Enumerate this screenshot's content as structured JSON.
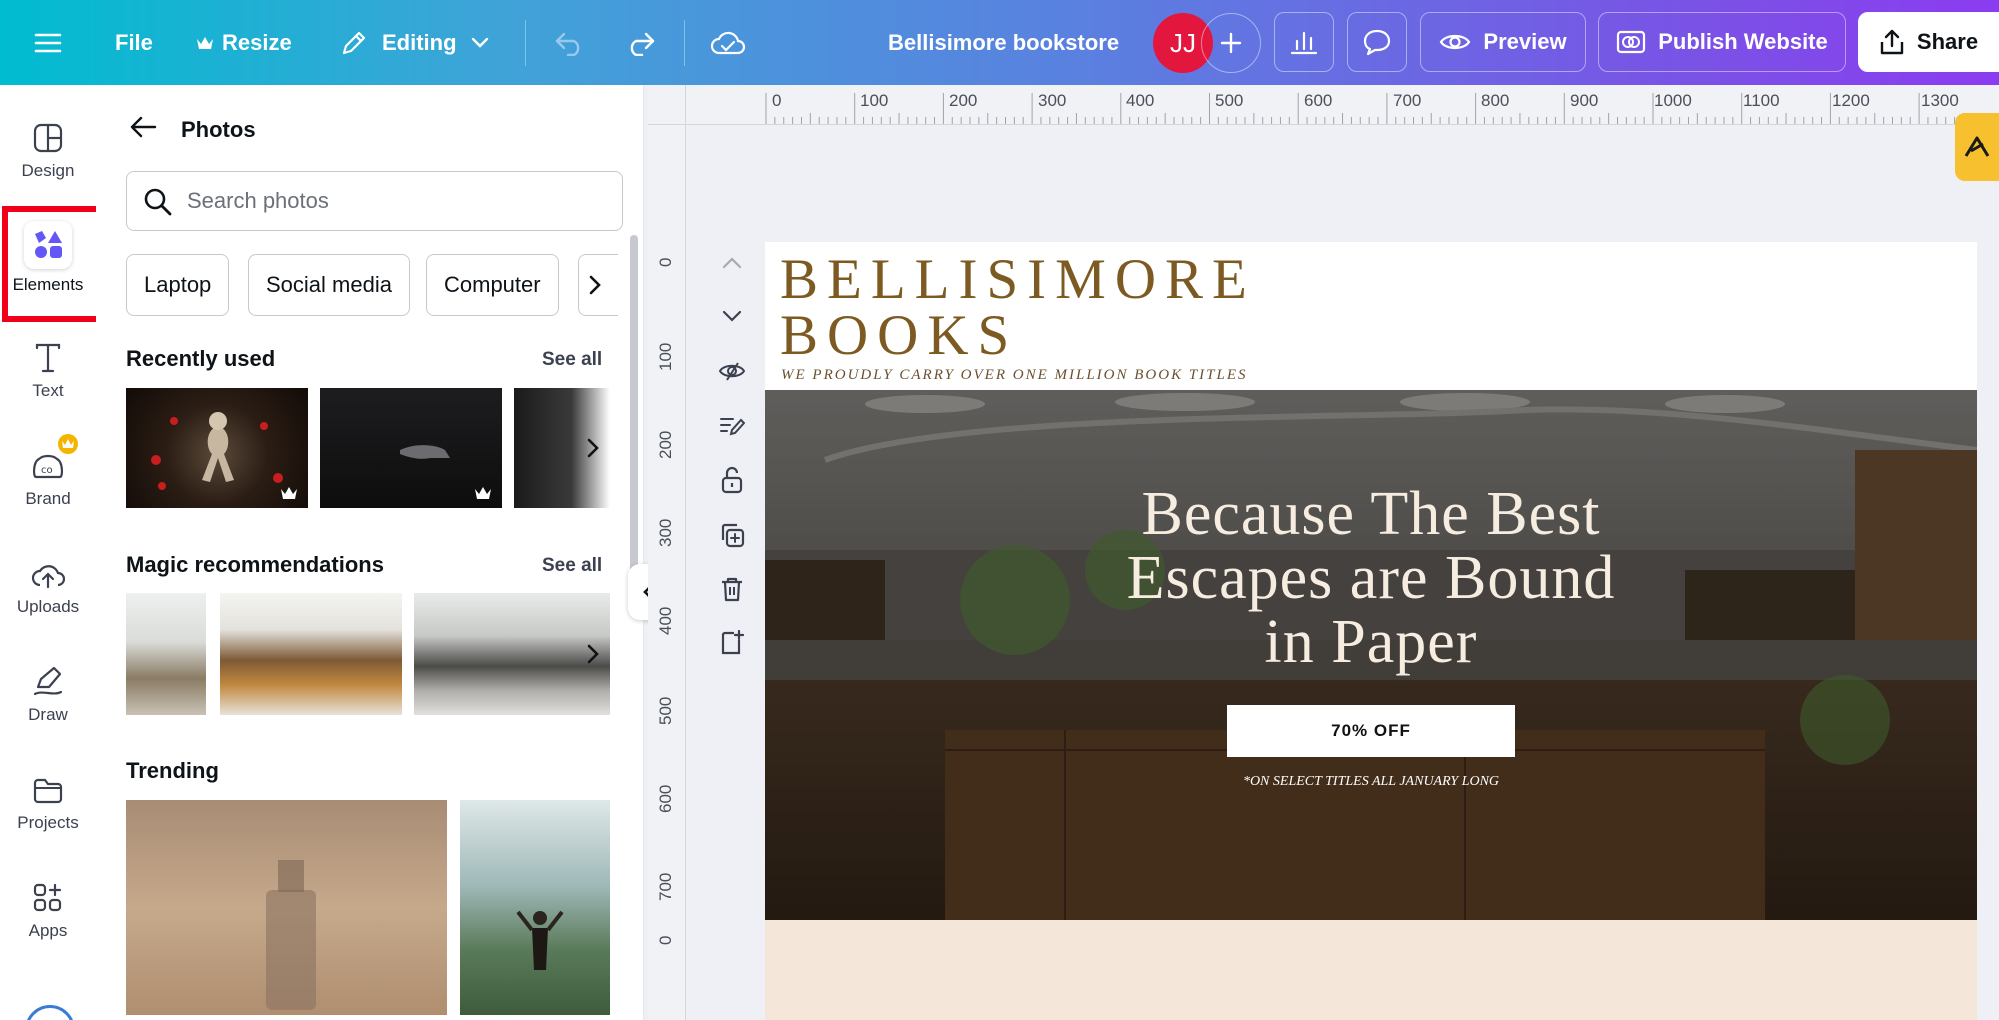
{
  "topbar": {
    "file_label": "File",
    "resize_label": "Resize",
    "editing_label": "Editing",
    "doc_title": "Bellisimore bookstore",
    "avatar_initials": "JJ",
    "preview_label": "Preview",
    "publish_label": "Publish Website",
    "share_label": "Share"
  },
  "rail": {
    "items": [
      {
        "label": "Design",
        "icon": "layout-icon"
      },
      {
        "label": "Elements",
        "icon": "shapes-icon"
      },
      {
        "label": "Text",
        "icon": "text-icon"
      },
      {
        "label": "Brand",
        "icon": "brand-icon"
      },
      {
        "label": "Uploads",
        "icon": "cloud-upload-icon"
      },
      {
        "label": "Draw",
        "icon": "pen-icon"
      },
      {
        "label": "Projects",
        "icon": "folder-icon"
      },
      {
        "label": "Apps",
        "icon": "apps-icon"
      }
    ],
    "active": "Elements"
  },
  "panel": {
    "title": "Photos",
    "search_placeholder": "Search photos",
    "chips": [
      "Laptop",
      "Social media",
      "Computer"
    ],
    "recent_title": "Recently used",
    "magic_title": "Magic recommendations",
    "trending_title": "Trending",
    "see_all": "See all"
  },
  "ruler": {
    "h": [
      "0",
      "100",
      "200",
      "300",
      "400",
      "500",
      "600",
      "700",
      "800",
      "900",
      "1000",
      "1100",
      "1200",
      "1300"
    ],
    "v": [
      "0",
      "100",
      "200",
      "300",
      "400",
      "500",
      "600",
      "700",
      "0"
    ]
  },
  "design": {
    "brand_line1": "BELLISIMORE",
    "brand_line2": "BOOKS",
    "tagline": "WE PROUDLY CARRY OVER ONE MILLION BOOK TITLES",
    "headline_1": "Because The Best",
    "headline_2": "Escapes are Bound",
    "headline_3": "in Paper",
    "cta": "70% OFF",
    "cta_note": "*ON SELECT TITLES ALL JANUARY LONG"
  },
  "colors": {
    "brand_gold": "#7c5a22",
    "accent_red": "#f1001b",
    "avatar_red": "#e3173e"
  }
}
